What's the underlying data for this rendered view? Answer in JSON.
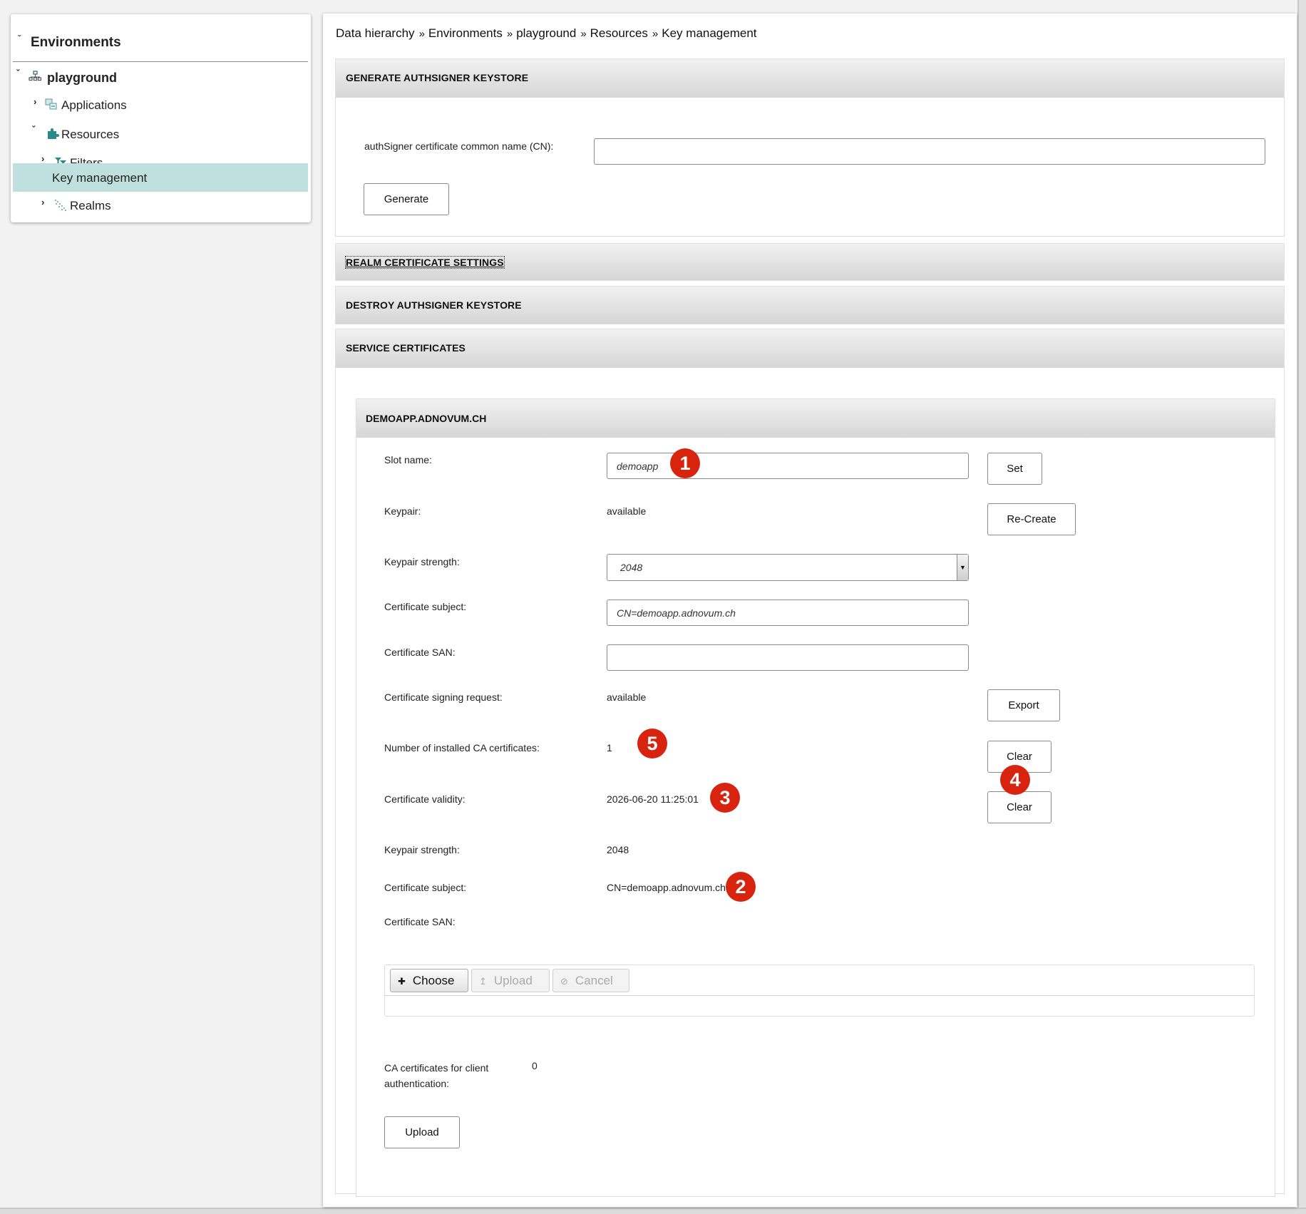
{
  "sidebar": {
    "root": {
      "label": "Environments",
      "expanded": true
    },
    "items": [
      {
        "label": "playground",
        "icon": "network-icon",
        "expanded": true,
        "bold": true
      },
      {
        "label": "Applications",
        "icon": "applications-icon",
        "expanded": false
      },
      {
        "label": "Resources",
        "icon": "puzzle-icon",
        "expanded": true
      },
      {
        "label": "Filters",
        "icon": "filter-icon",
        "expanded": false
      },
      {
        "label": "Key management",
        "selected": true
      },
      {
        "label": "Realms",
        "icon": "realms-icon",
        "expanded": false
      }
    ]
  },
  "breadcrumb": [
    "Data hierarchy",
    "Environments",
    "playground",
    "Resources",
    "Key management"
  ],
  "breadcrumb_separator": "»",
  "sections": {
    "generate": {
      "title": "GENERATE AUTHSIGNER KEYSTORE",
      "cn_label": "authSigner certificate common name (CN):",
      "cn_value": "",
      "generate_button": "Generate"
    },
    "realm": {
      "title": "REALM CERTIFICATE SETTINGS"
    },
    "destroy": {
      "title": "DESTROY AUTHSIGNER KEYSTORE"
    },
    "service": {
      "title": "SERVICE CERTIFICATES"
    }
  },
  "service_cert": {
    "title": "DEMOAPP.ADNOVUM.CH",
    "slot_name_label": "Slot name:",
    "slot_name_value": "demoapp",
    "set_button": "Set",
    "keypair_label": "Keypair:",
    "keypair_value": "available",
    "recreate_button": "Re-Create",
    "keypair_strength_label": "Keypair strength:",
    "keypair_strength_selected": "2048",
    "cert_subject_label": "Certificate subject:",
    "cert_subject_value": "CN=demoapp.adnovum.ch",
    "cert_san_label": "Certificate SAN:",
    "cert_san_value": "",
    "csr_label": "Certificate signing request:",
    "csr_value": "available",
    "export_button": "Export",
    "ca_count_label": "Number of installed CA certificates:",
    "ca_count_value": "1",
    "clear_button_1": "Clear",
    "validity_label": "Certificate validity:",
    "validity_value": "2026-06-20 11:25:01",
    "clear_button_2": "Clear",
    "installed_strength_label": "Keypair strength:",
    "installed_strength_value": "2048",
    "installed_subject_label": "Certificate subject:",
    "installed_subject_value": "CN=demoapp.adnovum.ch",
    "installed_san_label": "Certificate SAN:",
    "installed_san_value": "",
    "file_upload": {
      "choose": "Choose",
      "upload": "Upload",
      "cancel": "Cancel"
    },
    "client_ca_label": "CA certificates for client authentication:",
    "client_ca_value": "0",
    "upload_button": "Upload"
  },
  "annotations": {
    "badge_1": "1",
    "badge_2": "2",
    "badge_3": "3",
    "badge_4": "4",
    "badge_5": "5",
    "color": "#d8240f"
  },
  "colors": {
    "selected_item_bg": "#c0dfdf",
    "accent_icon": "#2a8a8a"
  }
}
